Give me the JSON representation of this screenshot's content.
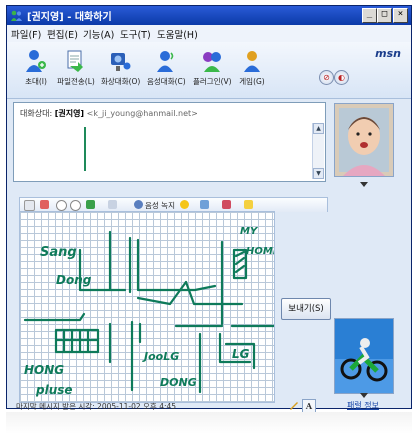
{
  "window": {
    "title": "[권지영] - 대화하기",
    "controls": [
      "_",
      "□",
      "×"
    ]
  },
  "menu": [
    "파일(F)",
    "편집(E)",
    "기능(A)",
    "도구(T)",
    "도움말(H)"
  ],
  "toolbar": {
    "buttons": [
      {
        "label": "초대(I)",
        "icon": "invite-person-icon"
      },
      {
        "label": "파일전송(L)",
        "icon": "file-transfer-icon"
      },
      {
        "label": "화상대화(O)",
        "icon": "video-chat-icon"
      },
      {
        "label": "음성대화(C)",
        "icon": "voice-chat-icon"
      },
      {
        "label": "플러그인(V)",
        "icon": "plugin-icon"
      },
      {
        "label": "게임(G)",
        "icon": "games-icon"
      }
    ],
    "brand": "msn"
  },
  "conversation": {
    "to_prefix": "대화상대:",
    "to_name": "[권지영]",
    "to_email": "<k_ji_young@hanmail.net>"
  },
  "format_toolbar": {
    "voice_clip": "음성 녹지"
  },
  "drawing": {
    "labels": [
      "Sang",
      "Dong",
      "MY",
      "HOME",
      "HONG",
      "pluse",
      "JooLG",
      "DONG",
      "LG"
    ]
  },
  "send_button": "보내기(S)",
  "status": {
    "last_message": "마지막 메시지 받은 시각: 2005-11-02 오후 4:45",
    "font_button": "A"
  },
  "sidebar": {
    "info_link": "패럴 정보"
  }
}
